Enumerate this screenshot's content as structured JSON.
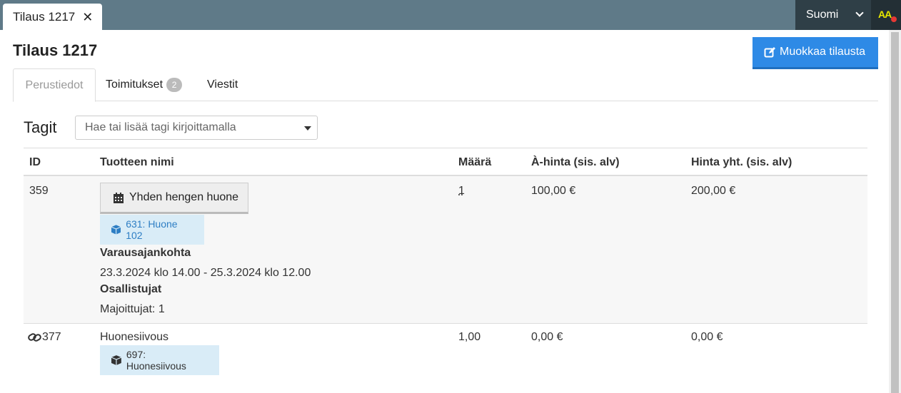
{
  "window": {
    "tab_title": "Tilaus 1217",
    "language": "Suomi",
    "accessibility_label": "AA"
  },
  "page": {
    "title": "Tilaus 1217",
    "edit_button": "Muokkaa tilausta"
  },
  "tabs": [
    {
      "label": "Perustiedot",
      "active": true
    },
    {
      "label": "Toimitukset",
      "badge": "2"
    },
    {
      "label": "Viestit"
    }
  ],
  "tags": {
    "label": "Tagit",
    "placeholder": "Hae tai lisää tagi kirjoittamalla"
  },
  "table": {
    "headers": [
      "ID",
      "Tuotteen nimi",
      "Määrä",
      "À-hinta (sis. alv)",
      "Hinta yht. (sis. alv)"
    ],
    "rows": [
      {
        "id": "359",
        "product": "Yhden hengen huone",
        "resource": "631: Huone 102",
        "period_label": "Varausajankohta",
        "period_value": "23.3.2024 klo 14.00 - 25.3.2024 klo 12.00",
        "participants_label": "Osallistujat",
        "participants_value": "Majoittujat: 1",
        "quantity": "1",
        "unit_price": "100,00 €",
        "total": "200,00 €"
      },
      {
        "id": "377",
        "product": "Huonesiivous",
        "resource": "697: Huonesiivous",
        "quantity": "1,00",
        "unit_price": "0,00 €",
        "total": "0,00 €"
      }
    ]
  },
  "colors": {
    "topbar": "#5f7a88",
    "primary": "#2e8ae6",
    "chip": "#d9ecf7"
  }
}
